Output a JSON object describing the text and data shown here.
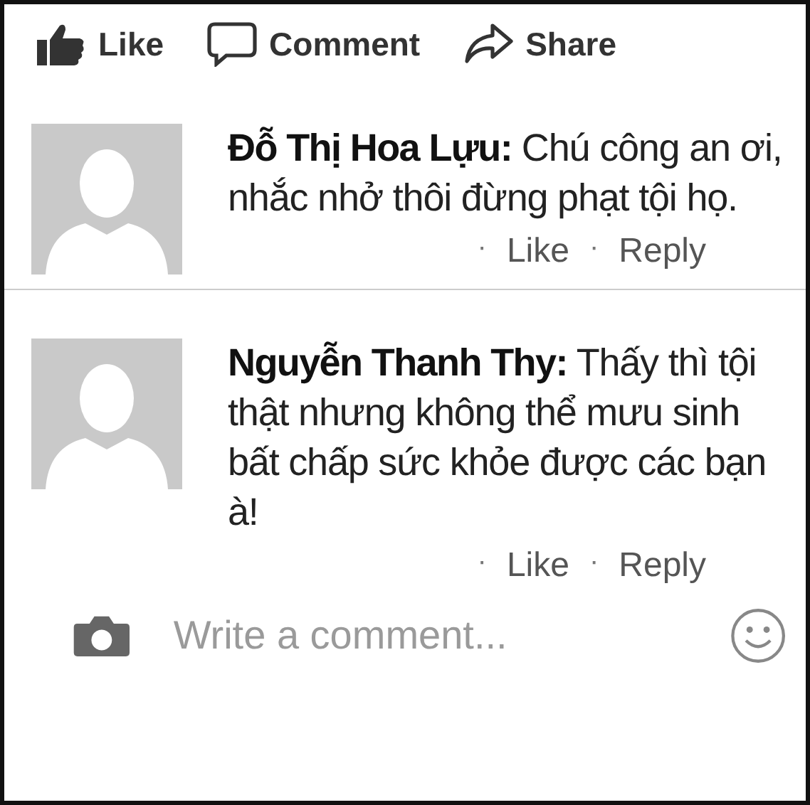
{
  "actions": [
    {
      "kind": "like",
      "label": "Like"
    },
    {
      "kind": "comment",
      "label": "Comment"
    },
    {
      "kind": "share",
      "label": "Share"
    }
  ],
  "comments": [
    {
      "text": "**Đỗ Thị Hoa Lựu:** Chú công an ơi, nhắc nhở thôi đừng phạt tội họ.",
      "links": [
        {
          "bullet": "·",
          "label": "Like"
        },
        {
          "bullet": "·",
          "label": "Reply"
        }
      ]
    },
    {
      "text": "**Nguyễn Thanh Thy:** Thấy thì tội thật nhưng không thể mưu sinh bất chấp sức khỏe được các bạn à!",
      "links": [
        {
          "bullet": "·",
          "label": "Like"
        },
        {
          "bullet": "·",
          "label": "Reply"
        }
      ]
    }
  ],
  "composer": {
    "placeholder": "Write a comment..."
  }
}
